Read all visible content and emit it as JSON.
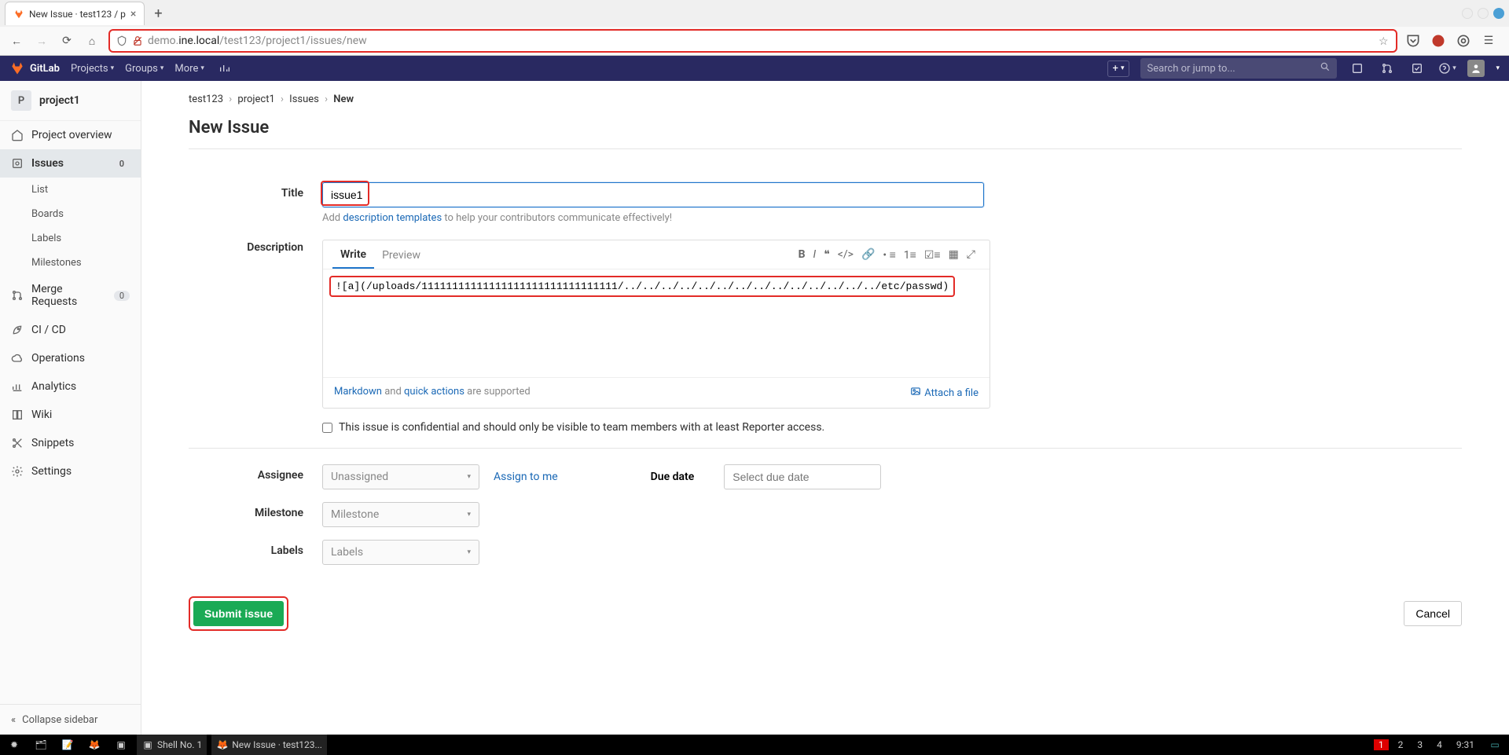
{
  "browser": {
    "tab_title": "New Issue · test123 / p",
    "url_prefix": "demo.",
    "url_host": "ine.local",
    "url_path": "/test123/project1/issues/new"
  },
  "navbar": {
    "brand": "GitLab",
    "projects": "Projects",
    "groups": "Groups",
    "more": "More",
    "search_placeholder": "Search or jump to..."
  },
  "sidebar": {
    "project_initial": "P",
    "project_name": "project1",
    "overview": "Project overview",
    "issues": "Issues",
    "issues_count": "0",
    "list": "List",
    "boards": "Boards",
    "labels": "Labels",
    "milestones": "Milestones",
    "merge_requests": "Merge Requests",
    "mr_count": "0",
    "cicd": "CI / CD",
    "operations": "Operations",
    "analytics": "Analytics",
    "wiki": "Wiki",
    "snippets": "Snippets",
    "settings": "Settings",
    "collapse": "Collapse sidebar"
  },
  "breadcrumbs": {
    "a": "test123",
    "b": "project1",
    "c": "Issues",
    "d": "New"
  },
  "page": {
    "title": "New Issue",
    "title_label": "Title",
    "title_value": "issue1",
    "hint_pre": "Add ",
    "hint_link": "description templates",
    "hint_post": " to help your contributors communicate effectively!",
    "desc_label": "Description",
    "write_tab": "Write",
    "preview_tab": "Preview",
    "desc_value": "![a](/uploads/11111111111111111111111111111111/../../../../../../../../../../../../../../etc/passwd)",
    "md_pre": "Markdown",
    "md_and": " and ",
    "md_qa": "quick actions",
    "md_post": " are supported",
    "attach": "Attach a file",
    "confidential": "This issue is confidential and should only be visible to team members with at least Reporter access.",
    "assignee_label": "Assignee",
    "assignee_value": "Unassigned",
    "assign_me": "Assign to me",
    "due_label": "Due date",
    "due_placeholder": "Select due date",
    "milestone_label": "Milestone",
    "milestone_value": "Milestone",
    "labels_label": "Labels",
    "labels_value": "Labels",
    "submit": "Submit issue",
    "cancel": "Cancel"
  },
  "taskbar": {
    "shell": "Shell No. 1",
    "firefox": "New Issue · test123...",
    "ws": [
      "1",
      "2",
      "3",
      "4"
    ],
    "clock": "9:31"
  }
}
